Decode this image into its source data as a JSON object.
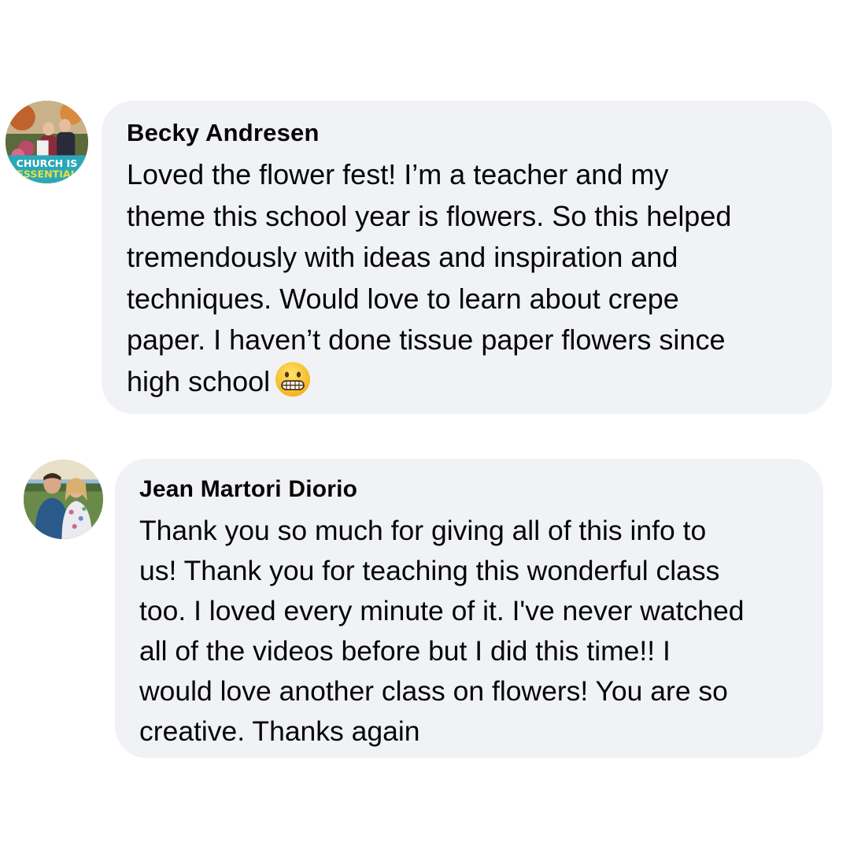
{
  "comments": [
    {
      "author": "Becky Andresen",
      "avatar_badge": "CHURCH IS ESSENTIAL",
      "text": "Loved the flower fest!  I’m a teacher and my\ntheme this school year is flowers. So this helped\ntremendously with ideas and inspiration and\ntechniques. Would love to learn about crepe\npaper. I haven’t done tissue paper flowers since\nhigh school",
      "emoji": "grimacing-face-emoji"
    },
    {
      "author": "Jean Martori Diorio",
      "text": "Thank you so much for giving all of this info to\nus! Thank you for teaching this wonderful class\ntoo. I loved every minute of it. I've never watched\nall of the videos before but I did this time!! I\nwould love another class on flowers! You are so\ncreative. Thanks again"
    }
  ],
  "colors": {
    "bubble_bg": "#f0f2f5",
    "text": "#050505",
    "background": "#ffffff"
  }
}
